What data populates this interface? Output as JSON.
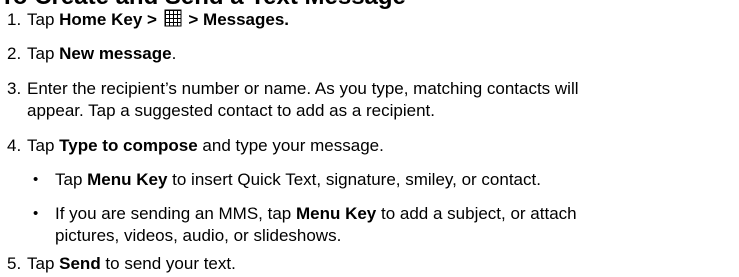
{
  "heading": "To Create and Send a Text Message",
  "steps": [
    {
      "num": "1.",
      "parts": [
        "Tap ",
        "Home Key > ",
        " > Messages."
      ],
      "icon": "apps-grid-icon"
    },
    {
      "num": "2.",
      "parts": [
        "Tap ",
        "New message",
        "."
      ]
    },
    {
      "num": "3.",
      "line1": "Enter the recipient’s number or name. As you type, matching contacts will",
      "line2": "appear. Tap a suggested contact to add as a recipient."
    },
    {
      "num": "4.",
      "parts": [
        "Tap ",
        "Type to compose",
        " and type your message."
      ],
      "bullets": [
        {
          "marker": "•",
          "parts": [
            "Tap ",
            "Menu Key",
            " to insert Quick Text, signature, smiley, or contact."
          ]
        },
        {
          "marker": "•",
          "parts": [
            "If you are sending an MMS, tap ",
            "Menu Key",
            " to add a subject, or attach"
          ],
          "line2": "pictures, videos, audio, or slideshows."
        }
      ]
    },
    {
      "num": "5.",
      "parts": [
        "Tap ",
        "Send",
        " to send your text."
      ]
    }
  ]
}
